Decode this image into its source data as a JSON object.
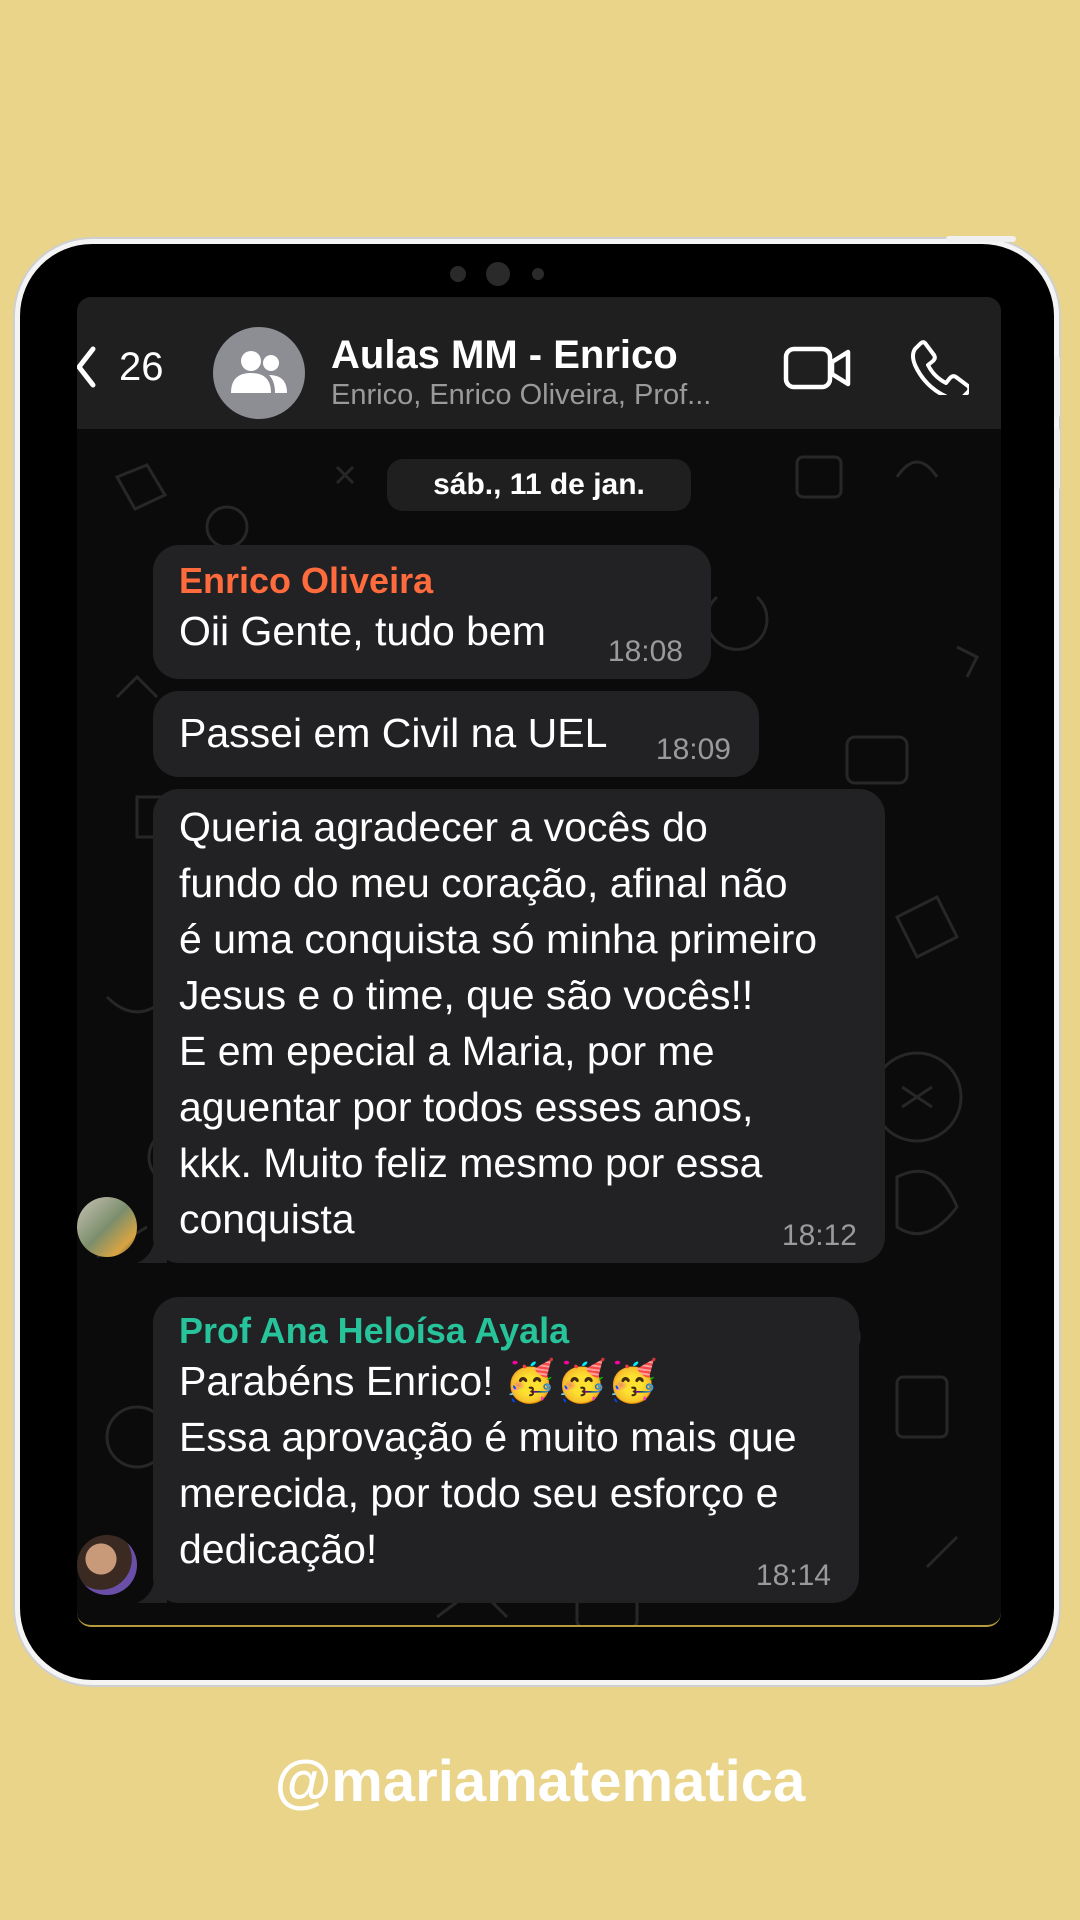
{
  "header": {
    "back_count": "26",
    "title": "Aulas MM - Enrico",
    "subtitle": "Enrico, Enrico Oliveira, Prof..."
  },
  "date_separator": "sáb., 11 de jan.",
  "messages": [
    {
      "sender": "Enrico Oliveira",
      "sender_color": "#ff6b3d",
      "text": "Oii Gente, tudo bem",
      "time": "18:08"
    },
    {
      "sender": "",
      "text": "Passei em Civil na UEL",
      "time": "18:09"
    },
    {
      "sender": "",
      "lines": [
        "Queria agradecer a vocês do",
        "fundo do meu coração, afinal não",
        "é uma conquista só minha primeiro",
        "Jesus e o time, que são vocês!!",
        "E em epecial a Maria, por me",
        "aguentar por todos esses anos,",
        "kkk. Muito feliz mesmo por essa",
        "conquista"
      ],
      "time": "18:12"
    },
    {
      "sender": "Prof Ana Heloísa Ayala",
      "sender_color": "#27c39b",
      "lines": [
        "Parabéns Enrico! 🥳🥳🥳",
        "Essa aprovação é muito mais que",
        "merecida, por todo seu esforço e",
        "dedicação!"
      ],
      "time": "18:14"
    }
  ],
  "footer_handle": "@mariamatematica",
  "colors": {
    "background": "#e9d48a",
    "bubble": "#222224",
    "header": "#1f1f1f"
  },
  "icons": [
    "back-chevron-icon",
    "group-avatar-icon",
    "video-call-icon",
    "phone-icon"
  ]
}
